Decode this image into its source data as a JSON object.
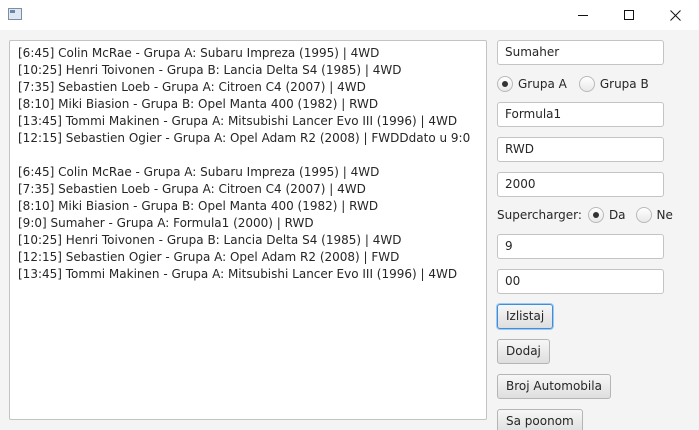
{
  "window": {
    "icon": "app-window-icon",
    "controls": [
      "minimize-icon",
      "maximize-icon",
      "close-icon"
    ]
  },
  "output": {
    "lines": [
      "[6:45] Colin McRae - Grupa A: Subaru Impreza (1995) | 4WD",
      "[10:25] Henri Toivonen - Grupa B: Lancia Delta S4 (1985) | 4WD",
      "[7:35] Sebastien Loeb - Grupa A: Citroen C4 (2007) | 4WD",
      "[8:10] Miki Biasion - Grupa B: Opel Manta 400 (1982) | RWD",
      "[13:45] Tommi Makinen - Grupa A: Mitsubishi Lancer Evo III (1996) | 4WD",
      "[12:15] Sebastien Ogier - Grupa A: Opel Adam R2 (2008) | FWDDdato u 9:0",
      "",
      "[6:45] Colin McRae - Grupa A: Subaru Impreza (1995) | 4WD",
      "[7:35] Sebastien Loeb - Grupa A: Citroen C4 (2007) | 4WD",
      "[8:10] Miki Biasion - Grupa B: Opel Manta 400 (1982) | RWD",
      "[9:0] Sumaher - Grupa A: Formula1 (2000) | RWD",
      "[10:25] Henri Toivonen - Grupa B: Lancia Delta S4 (1985) | 4WD",
      "[12:15] Sebastien Ogier - Grupa A: Opel Adam R2 (2008) | FWD",
      "[13:45] Tommi Makinen - Grupa A: Mitsubishi Lancer Evo III (1996) | 4WD"
    ]
  },
  "form": {
    "driver_name": "Sumaher",
    "group_a_label": "Grupa A",
    "group_b_label": "Grupa B",
    "selected_group": "Grupa A",
    "car_model": "Formula1",
    "drive": "RWD",
    "year": "2000",
    "supercharger_label": "Supercharger:",
    "supercharger_yes": "Da",
    "supercharger_no": "Ne",
    "selected_supercharger": "Da",
    "hour": "9",
    "minute": "00"
  },
  "buttons": {
    "list": "Izlistaj",
    "add": "Dodaj",
    "count": "Broj Automobila",
    "with_supercharger": "Sa poonom"
  }
}
